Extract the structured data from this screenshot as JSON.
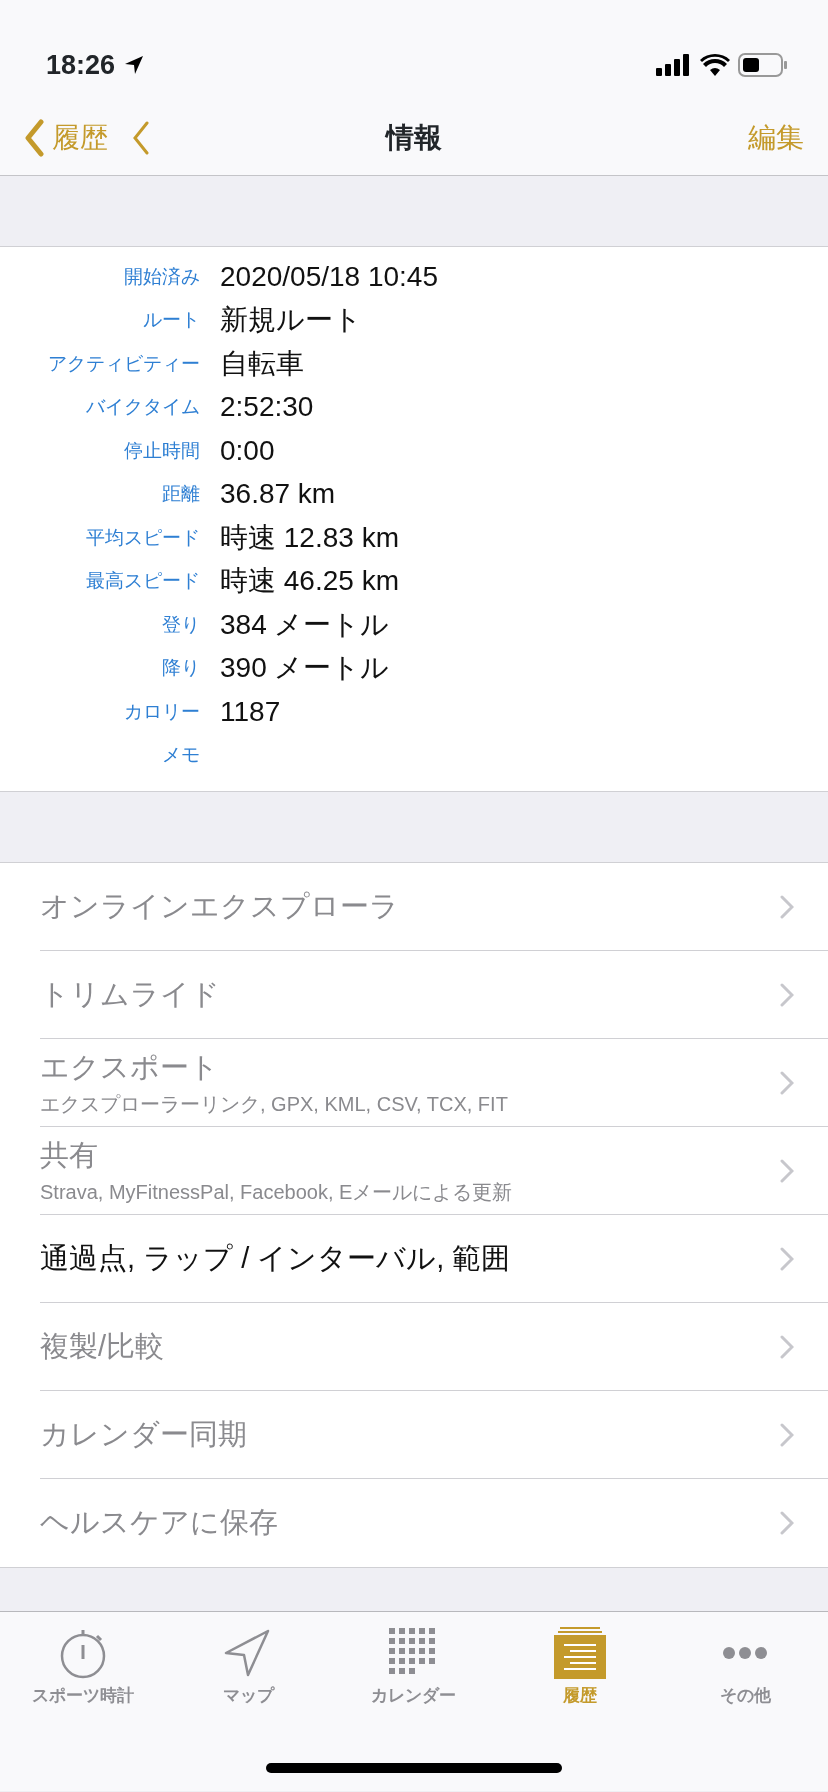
{
  "status_bar": {
    "time": "18:26"
  },
  "nav": {
    "back": "履歴",
    "title": "情報",
    "edit": "編集"
  },
  "details": [
    {
      "label": "開始済み",
      "value": "2020/05/18 10:45"
    },
    {
      "label": "ルート",
      "value": "新規ルート"
    },
    {
      "label": "アクティビティー",
      "value": "自転車"
    },
    {
      "label": "バイクタイム",
      "value": "2:52:30"
    },
    {
      "label": "停止時間",
      "value": "0:00"
    },
    {
      "label": "距離",
      "value": "36.87 km"
    },
    {
      "label": "平均スピード",
      "value": "時速 12.83 km"
    },
    {
      "label": "最高スピード",
      "value": "時速 46.25 km"
    },
    {
      "label": "登り",
      "value": "384 メートル"
    },
    {
      "label": "降り",
      "value": "390 メートル"
    },
    {
      "label": "カロリー",
      "value": "1187"
    },
    {
      "label": "メモ"
    }
  ],
  "menu": [
    {
      "title": "オンラインエクスプローラ",
      "disabled": true
    },
    {
      "title": "トリムライド",
      "disabled": true
    },
    {
      "title": "エクスポート",
      "subtitle": "エクスプローラーリンク, GPX, KML, CSV, TCX, FIT",
      "disabled": true
    },
    {
      "title": "共有",
      "subtitle": "Strava, MyFitnessPal, Facebook, Eメールによる更新",
      "disabled": true
    },
    {
      "title": "通過点, ラップ / インターバル, 範囲",
      "disabled": false
    },
    {
      "title": "複製/比較",
      "disabled": true
    },
    {
      "title": "カレンダー同期",
      "disabled": true
    },
    {
      "title": "ヘルスケアに保存",
      "disabled": true
    }
  ],
  "tabs": [
    {
      "kind": "stopwatch",
      "label": "スポーツ時計",
      "selected": false
    },
    {
      "kind": "map",
      "label": "マップ",
      "selected": false
    },
    {
      "kind": "calendar",
      "label": "カレンダー",
      "selected": false
    },
    {
      "kind": "history",
      "label": "履歴",
      "selected": true
    },
    {
      "kind": "more",
      "label": "その他",
      "selected": false
    }
  ]
}
